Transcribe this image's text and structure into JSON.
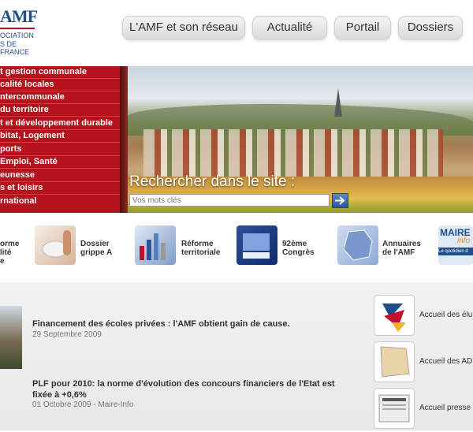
{
  "logo": {
    "brand": "AMF",
    "line1": "OCIATION",
    "line2": "S DE FRANCE"
  },
  "tabs": [
    "L'AMF et son réseau",
    "Actualité",
    "Portail",
    "Dossiers"
  ],
  "menu": [
    "t gestion communale",
    "calité locales",
    "ntercommunale",
    " du territoire",
    "t et développement durable",
    "bitat, Logement",
    "ports",
    "Emploi, Santé",
    "eunesse",
    "s et loisirs",
    "rnational"
  ],
  "search": {
    "label": "Rechercher dans le site :",
    "placeholder": "Vos mots clés"
  },
  "shortcuts": [
    {
      "label": "orme\nlité\ne",
      "icon": "form-icon"
    },
    {
      "label": "Dossier\ngrippe A",
      "icon": "mask-hand-icon"
    },
    {
      "label": "Réforme\nterritoriale",
      "icon": "chart-icon"
    },
    {
      "label": "92ème\nCongrès",
      "icon": "congress-screen-icon"
    },
    {
      "label": "Annuaires\nde l'AMF",
      "icon": "france-map-icon"
    },
    {
      "label": "MAIRE",
      "sub": "info",
      "tag": "Le quotidien d",
      "icon": "maire-info-icon"
    }
  ],
  "news": [
    {
      "title": "Financement des écoles privées : l'AMF obtient gain de cause.",
      "date": "29 Septembre 2009"
    },
    {
      "title": "PLF pour 2010: la norme d'évolution des concours financiers de l'Etat est fixée à +0,6%",
      "date": "01 Octobre 2009 - Maire-Info"
    }
  ],
  "side_links": [
    "Accueil des élu",
    "Accueil des AD",
    "Accueil presse"
  ],
  "colors": {
    "menu_bg": "#b5121b",
    "brand_blue": "#1f4f8b"
  }
}
